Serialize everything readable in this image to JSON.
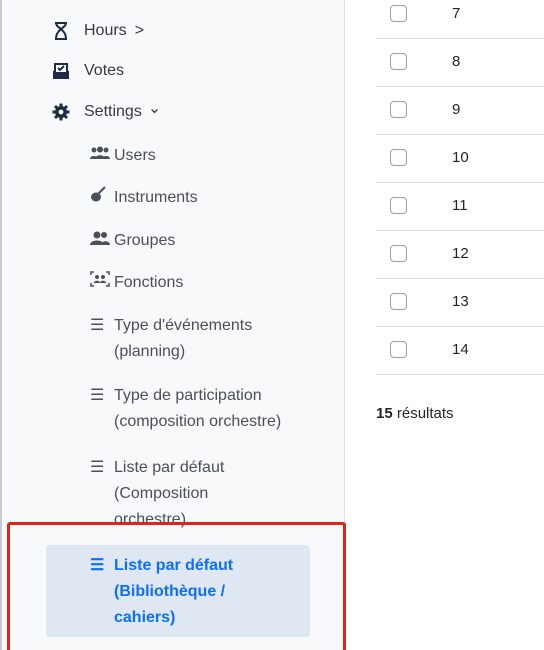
{
  "sidebar": {
    "main": [
      {
        "label": "Hours",
        "suffix": ">",
        "icon": "hourglass-icon"
      },
      {
        "label": "Votes",
        "icon": "vote-box-icon"
      },
      {
        "label": "Settings",
        "suffix": "⌄",
        "icon": "gear-icon"
      }
    ],
    "sub": [
      {
        "label": "Users",
        "icon": "users-icon"
      },
      {
        "label": "Instruments",
        "icon": "guitar-icon"
      },
      {
        "label": "Groupes",
        "icon": "group-icon"
      },
      {
        "label": "Fonctions",
        "icon": "id-badge-icon"
      },
      {
        "line1": "Type d'événements",
        "line2": "(planning)",
        "icon": "list-icon"
      },
      {
        "line1": "Type de participation",
        "line2": "(composition orchestre)",
        "icon": "list-icon"
      },
      {
        "line1": "Liste par défaut",
        "line2": "(Composition",
        "line3": "orchestre)",
        "icon": "list-icon"
      },
      {
        "line1": "Liste par défaut",
        "line2": "(Bibliothèque /",
        "line3": "cahiers)",
        "icon": "list-icon",
        "active": true
      }
    ]
  },
  "table": {
    "rows": [
      "7",
      "8",
      "9",
      "10",
      "11",
      "12",
      "13",
      "14"
    ],
    "results_count": "15",
    "results_label": "résultats"
  },
  "colors": {
    "accent": "#0d6efd",
    "highlight": "#e1231e",
    "active_bg": "#dfe7f2"
  }
}
